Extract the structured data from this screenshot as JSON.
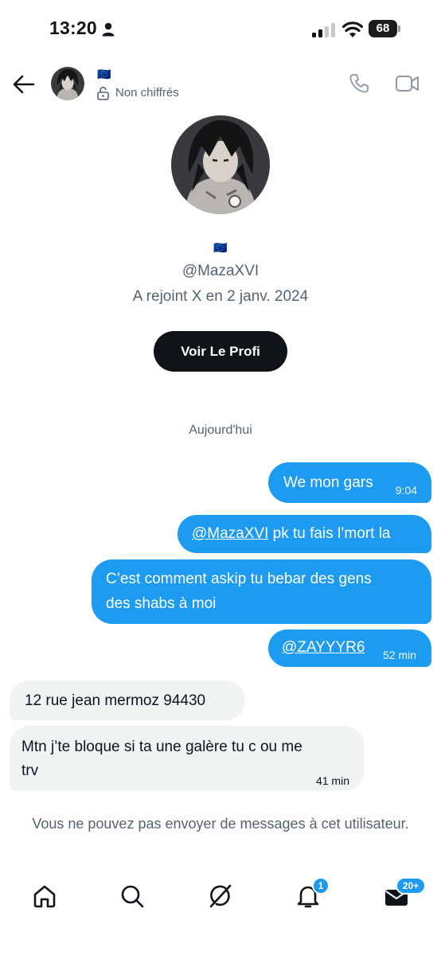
{
  "status_bar": {
    "time": "13:20",
    "battery_percent": "68"
  },
  "header": {
    "flag": "🇪🇺",
    "encryption_status": "Non chiffrés"
  },
  "profile": {
    "flag": "🇪🇺",
    "handle": "@MazaXVI",
    "joined": "A rejoint X en 2 janv. 2024",
    "view_profile_label": "Voir Le Profi"
  },
  "conversation": {
    "date_label": "Aujourd'hui",
    "messages": [
      {
        "direction": "out",
        "text": "We mon gars",
        "time": "9:04"
      },
      {
        "direction": "out",
        "mention": "@MazaXVI",
        "text": " pk tu fais l’mort la"
      },
      {
        "direction": "out",
        "line1": "C’est comment askip tu bebar des gens",
        "line2": "des shabs à moi"
      },
      {
        "direction": "out",
        "mention": "@ZAYYYR6",
        "time": "52 min"
      },
      {
        "direction": "in",
        "text": "12 rue jean mermoz 94430"
      },
      {
        "direction": "in",
        "line1": "Mtn j’te bloque si ta une galère tu c ou me",
        "line2": "trv",
        "time": "41 min"
      }
    ]
  },
  "notice": "Vous ne pouvez pas envoyer de messages à cet utilisateur.",
  "nav": {
    "notifications_badge": "1",
    "messages_badge": "20+"
  },
  "colors": {
    "accent": "#1d9bf0",
    "dark_button": "#0f1419",
    "incoming_bubble": "#eff3f4",
    "secondary_text": "#536471"
  },
  "icons": [
    "person-icon",
    "signal-icon",
    "wifi-icon",
    "back-arrow-icon",
    "lock-open-icon",
    "phone-icon",
    "video-icon",
    "home-icon",
    "search-icon",
    "grok-icon",
    "bell-icon",
    "mail-icon"
  ]
}
